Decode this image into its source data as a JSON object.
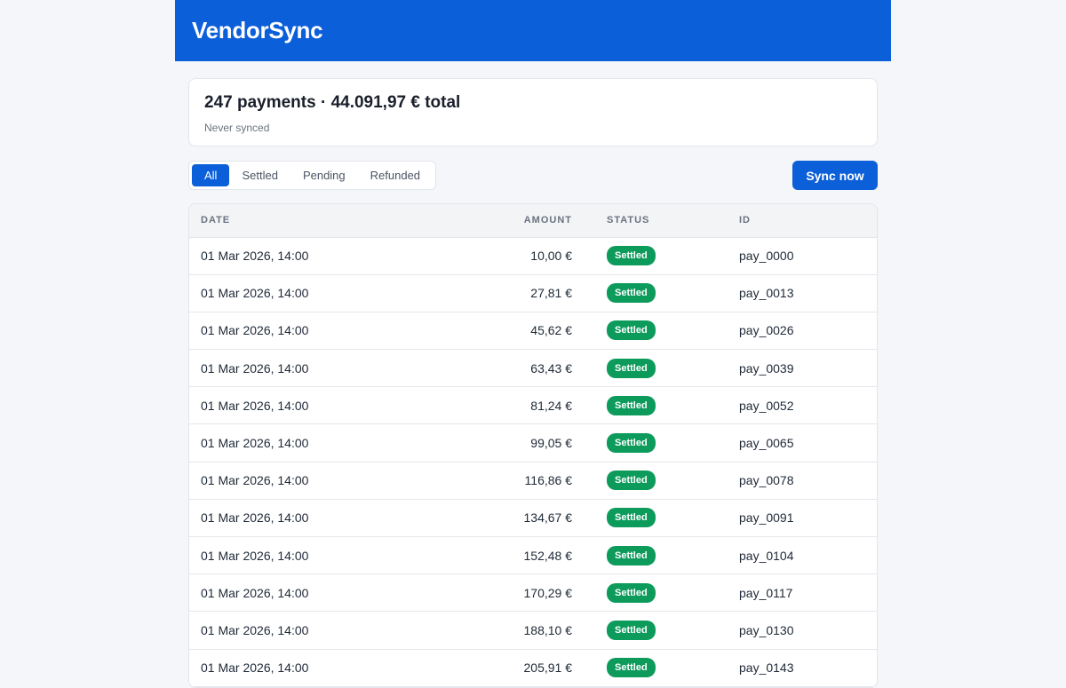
{
  "app": {
    "title": "VendorSync"
  },
  "summary": {
    "title": "247 payments · 44.091,97 € total",
    "sync_status": "Never synced"
  },
  "filters": {
    "tabs": [
      {
        "label": "All",
        "active": true
      },
      {
        "label": "Settled",
        "active": false
      },
      {
        "label": "Pending",
        "active": false
      },
      {
        "label": "Refunded",
        "active": false
      }
    ]
  },
  "toolbar": {
    "sync_label": "Sync now"
  },
  "table": {
    "headers": {
      "date": "DATE",
      "amount": "AMOUNT",
      "status": "STATUS",
      "id": "ID"
    },
    "rows": [
      {
        "date": "01 Mar 2026, 14:00",
        "amount": "10,00 €",
        "status": "Settled",
        "id": "pay_0000"
      },
      {
        "date": "01 Mar 2026, 14:00",
        "amount": "27,81 €",
        "status": "Settled",
        "id": "pay_0013"
      },
      {
        "date": "01 Mar 2026, 14:00",
        "amount": "45,62 €",
        "status": "Settled",
        "id": "pay_0026"
      },
      {
        "date": "01 Mar 2026, 14:00",
        "amount": "63,43 €",
        "status": "Settled",
        "id": "pay_0039"
      },
      {
        "date": "01 Mar 2026, 14:00",
        "amount": "81,24 €",
        "status": "Settled",
        "id": "pay_0052"
      },
      {
        "date": "01 Mar 2026, 14:00",
        "amount": "99,05 €",
        "status": "Settled",
        "id": "pay_0065"
      },
      {
        "date": "01 Mar 2026, 14:00",
        "amount": "116,86 €",
        "status": "Settled",
        "id": "pay_0078"
      },
      {
        "date": "01 Mar 2026, 14:00",
        "amount": "134,67 €",
        "status": "Settled",
        "id": "pay_0091"
      },
      {
        "date": "01 Mar 2026, 14:00",
        "amount": "152,48 €",
        "status": "Settled",
        "id": "pay_0104"
      },
      {
        "date": "01 Mar 2026, 14:00",
        "amount": "170,29 €",
        "status": "Settled",
        "id": "pay_0117"
      },
      {
        "date": "01 Mar 2026, 14:00",
        "amount": "188,10 €",
        "status": "Settled",
        "id": "pay_0130"
      },
      {
        "date": "01 Mar 2026, 14:00",
        "amount": "205,91 €",
        "status": "Settled",
        "id": "pay_0143"
      }
    ]
  },
  "colors": {
    "brand": "#0b5fd9",
    "settled": "#0d9b5c",
    "background": "#f4f6f9"
  }
}
